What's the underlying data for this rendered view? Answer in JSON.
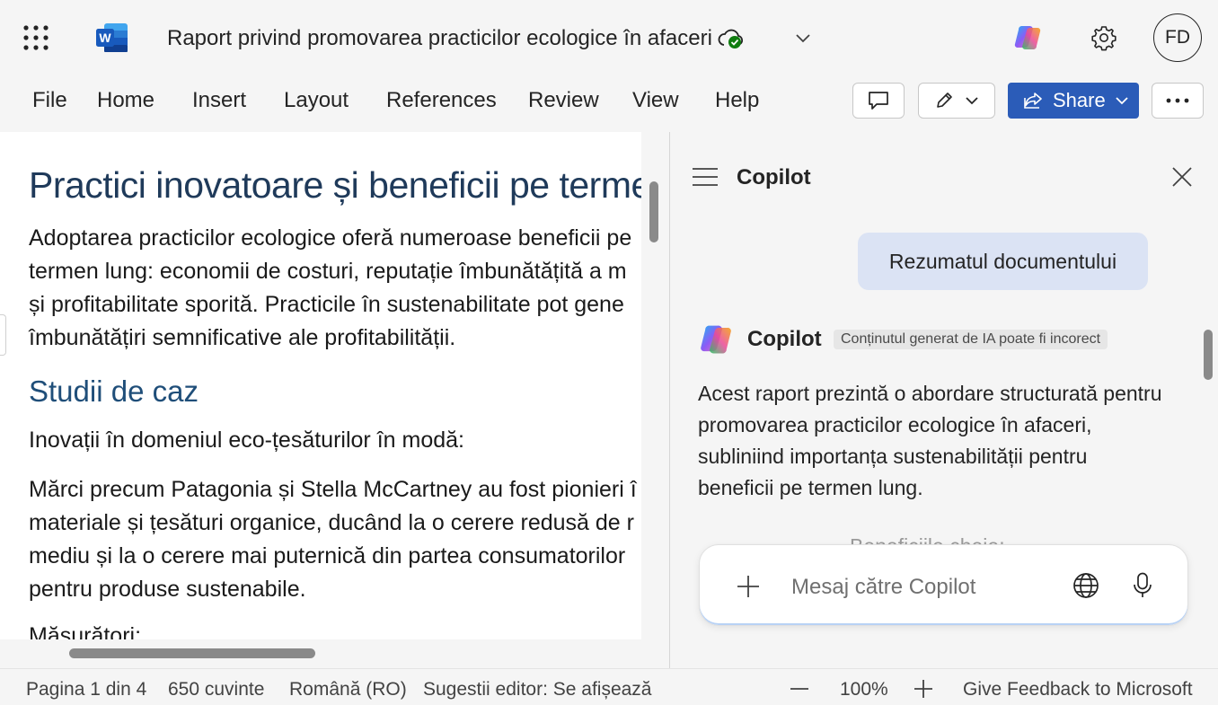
{
  "titlebar": {
    "doc_title": "Raport privind promovarea practicilor ecologice în afaceri",
    "avatar_initials": "FD"
  },
  "menu": [
    "File",
    "Home",
    "Insert",
    "Layout",
    "References",
    "Review",
    "View",
    "Help"
  ],
  "toolbar": {
    "share_label": "Share"
  },
  "document": {
    "heading1": "Practici inovatoare și beneficii pe termen lung",
    "para1": [
      "Adoptarea practicilor ecologice oferă numeroase beneficii pe",
      "termen lung: economii de costuri, reputație îmbunătățită a m",
      "și profitabilitate sporită. Practicile în sustenabilitate pot gene",
      "îmbunătățiri semnificative ale profitabilității."
    ],
    "heading2": "Studii de caz",
    "para2": "Inovații în domeniul eco-țesăturilor în modă:",
    "para3": [
      "Mărci precum Patagonia și Stella McCartney au fost pionieri î",
      "materiale și țesături organice, ducând la o cerere redusă de r",
      "mediu și la o cerere mai puternică din partea consumatorilor",
      "pentru produse sustenabile."
    ],
    "para4": "Măsurători:"
  },
  "copilot": {
    "title": "Copilot",
    "user_message": "Rezumatul documentului",
    "assistant_name": "Copilot",
    "ai_disclaimer": "Conținutul generat de IA poate fi incorect",
    "response": "Acest raport prezintă o abordare structurată pentru promovarea practicilor ecologice în afaceri, subliniind importanța sustenabilității pentru beneficii pe termen lung.",
    "faded_text": "Beneficiile cheie:",
    "input_placeholder": "Mesaj către Copilot"
  },
  "status": {
    "page": "Pagina 1 din 4",
    "words": "650 cuvinte",
    "language": "Română (RO)",
    "editor": "Sugestii editor: Se afișează",
    "zoom": "100%",
    "feedback": "Give Feedback to Microsoft"
  },
  "colors": {
    "share_blue": "#2b5cb8",
    "heading1": "#1f3a5a",
    "heading2": "#1f4e79",
    "user_bubble": "#dbe3f4"
  },
  "icons": [
    "app-launcher-icon",
    "word-logo-icon",
    "cloud-saved-icon",
    "chevron-down-icon",
    "copilot-icon",
    "gear-icon",
    "comment-icon",
    "pencil-icon",
    "share-icon",
    "more-icon",
    "hamburger-icon",
    "close-icon",
    "plus-icon",
    "globe-icon",
    "microphone-icon"
  ]
}
